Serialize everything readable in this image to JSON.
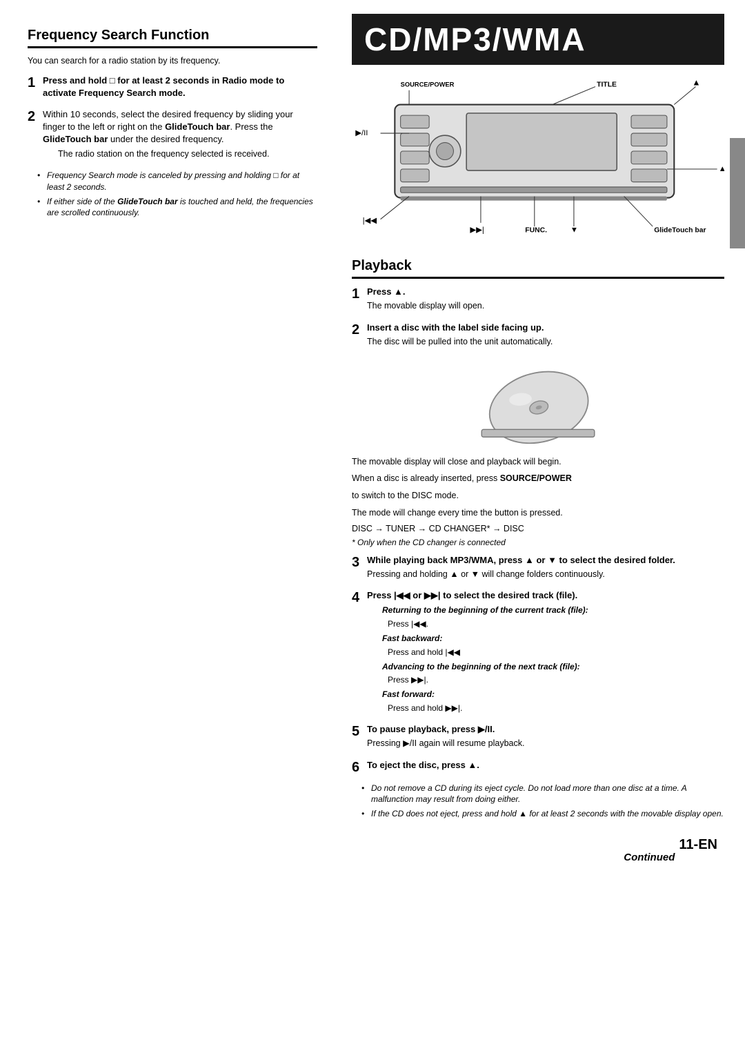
{
  "left": {
    "section_title": "Frequency Search Function",
    "intro": "You can search for a radio station by its frequency.",
    "steps": [
      {
        "num": "1",
        "text_bold": "Press and hold  for at least 2 seconds in Radio mode to activate Frequency Search mode."
      },
      {
        "num": "2",
        "text_intro": "Within 10 seconds, select the desired frequency by sliding your finger to the left or right on the",
        "text_bold1": "GlideTouch bar",
        "text_mid": ". Press the",
        "text_bold2": "GlideTouch bar",
        "text_end": "under the desired frequency.",
        "note": "The radio station on the frequency selected is received."
      }
    ],
    "bullets": [
      "Frequency Search mode is canceled by pressing and holding  for at least 2 seconds.",
      "If either side of the GlideTouch bar is touched and held, the frequencies are scrolled continuously."
    ]
  },
  "right": {
    "banner": "CD/MP3/WMA",
    "diagram": {
      "label_source_power": "SOURCE/POWER",
      "label_title": "TITLE",
      "label_play_pause": "▶/II",
      "label_func": "FUNC.",
      "label_down": "▼",
      "label_glidetouch": "GlideTouch bar",
      "label_up": "▲",
      "label_eject": "▲",
      "label_prev": "◀◀◀",
      "label_next": "▶▶▶"
    },
    "playback_title": "Playback",
    "playback_steps": [
      {
        "num": "1",
        "text_bold": "Press ▲.",
        "note": "The movable display will open."
      },
      {
        "num": "2",
        "text_bold": "Insert a disc with the label side facing up.",
        "note": "The disc will be pulled into the unit automatically."
      },
      {
        "num": "3",
        "text_bold": "While playing back MP3/WMA, press ▲ or ▼ to select the desired folder.",
        "note": "Pressing and holding ▲ or ▼ will change folders continuously."
      },
      {
        "num": "4",
        "text_bold": "Press |◀◀ or ▶▶| to select the desired track (file)."
      },
      {
        "num": "5",
        "text_bold": "To pause playback, press ▶/II.",
        "note": "Pressing ▶/II again will resume playback."
      },
      {
        "num": "6",
        "text_bold": "To eject the disc, press ▲."
      }
    ],
    "disc_desc1": "The movable display will close and playback will begin.",
    "disc_desc2_pre": "When a disc is already inserted, press ",
    "disc_desc2_bold": "SOURCE/POWER",
    "disc_desc2_post": "",
    "disc_desc3": "to switch to the DISC mode.",
    "disc_desc4": "The mode will change every time the button is pressed.",
    "disc_mode_line": "DISC → TUNER → CD CHANGER* → DISC",
    "asterisk_note": "*  Only when the CD changer is connected",
    "step4_sub": [
      {
        "label": "Returning to the beginning of the current track (file):",
        "text": "Press |◀◀."
      },
      {
        "label": "Fast backward:",
        "text": "Press and hold |◀◀"
      },
      {
        "label": "Advancing to the beginning of the next track (file):",
        "text": "Press ▶▶|."
      },
      {
        "label": "Fast forward:",
        "text": "Press and hold ▶▶|."
      }
    ],
    "step6_bullets": [
      "Do not remove a CD during its eject cycle. Do not load more than one disc at a time. A malfunction may result from doing either.",
      "If the CD does not eject, press and hold ▲ for at least 2 seconds with the movable display open."
    ],
    "continued": "Continued",
    "page_number": "11",
    "page_suffix": "-EN"
  }
}
